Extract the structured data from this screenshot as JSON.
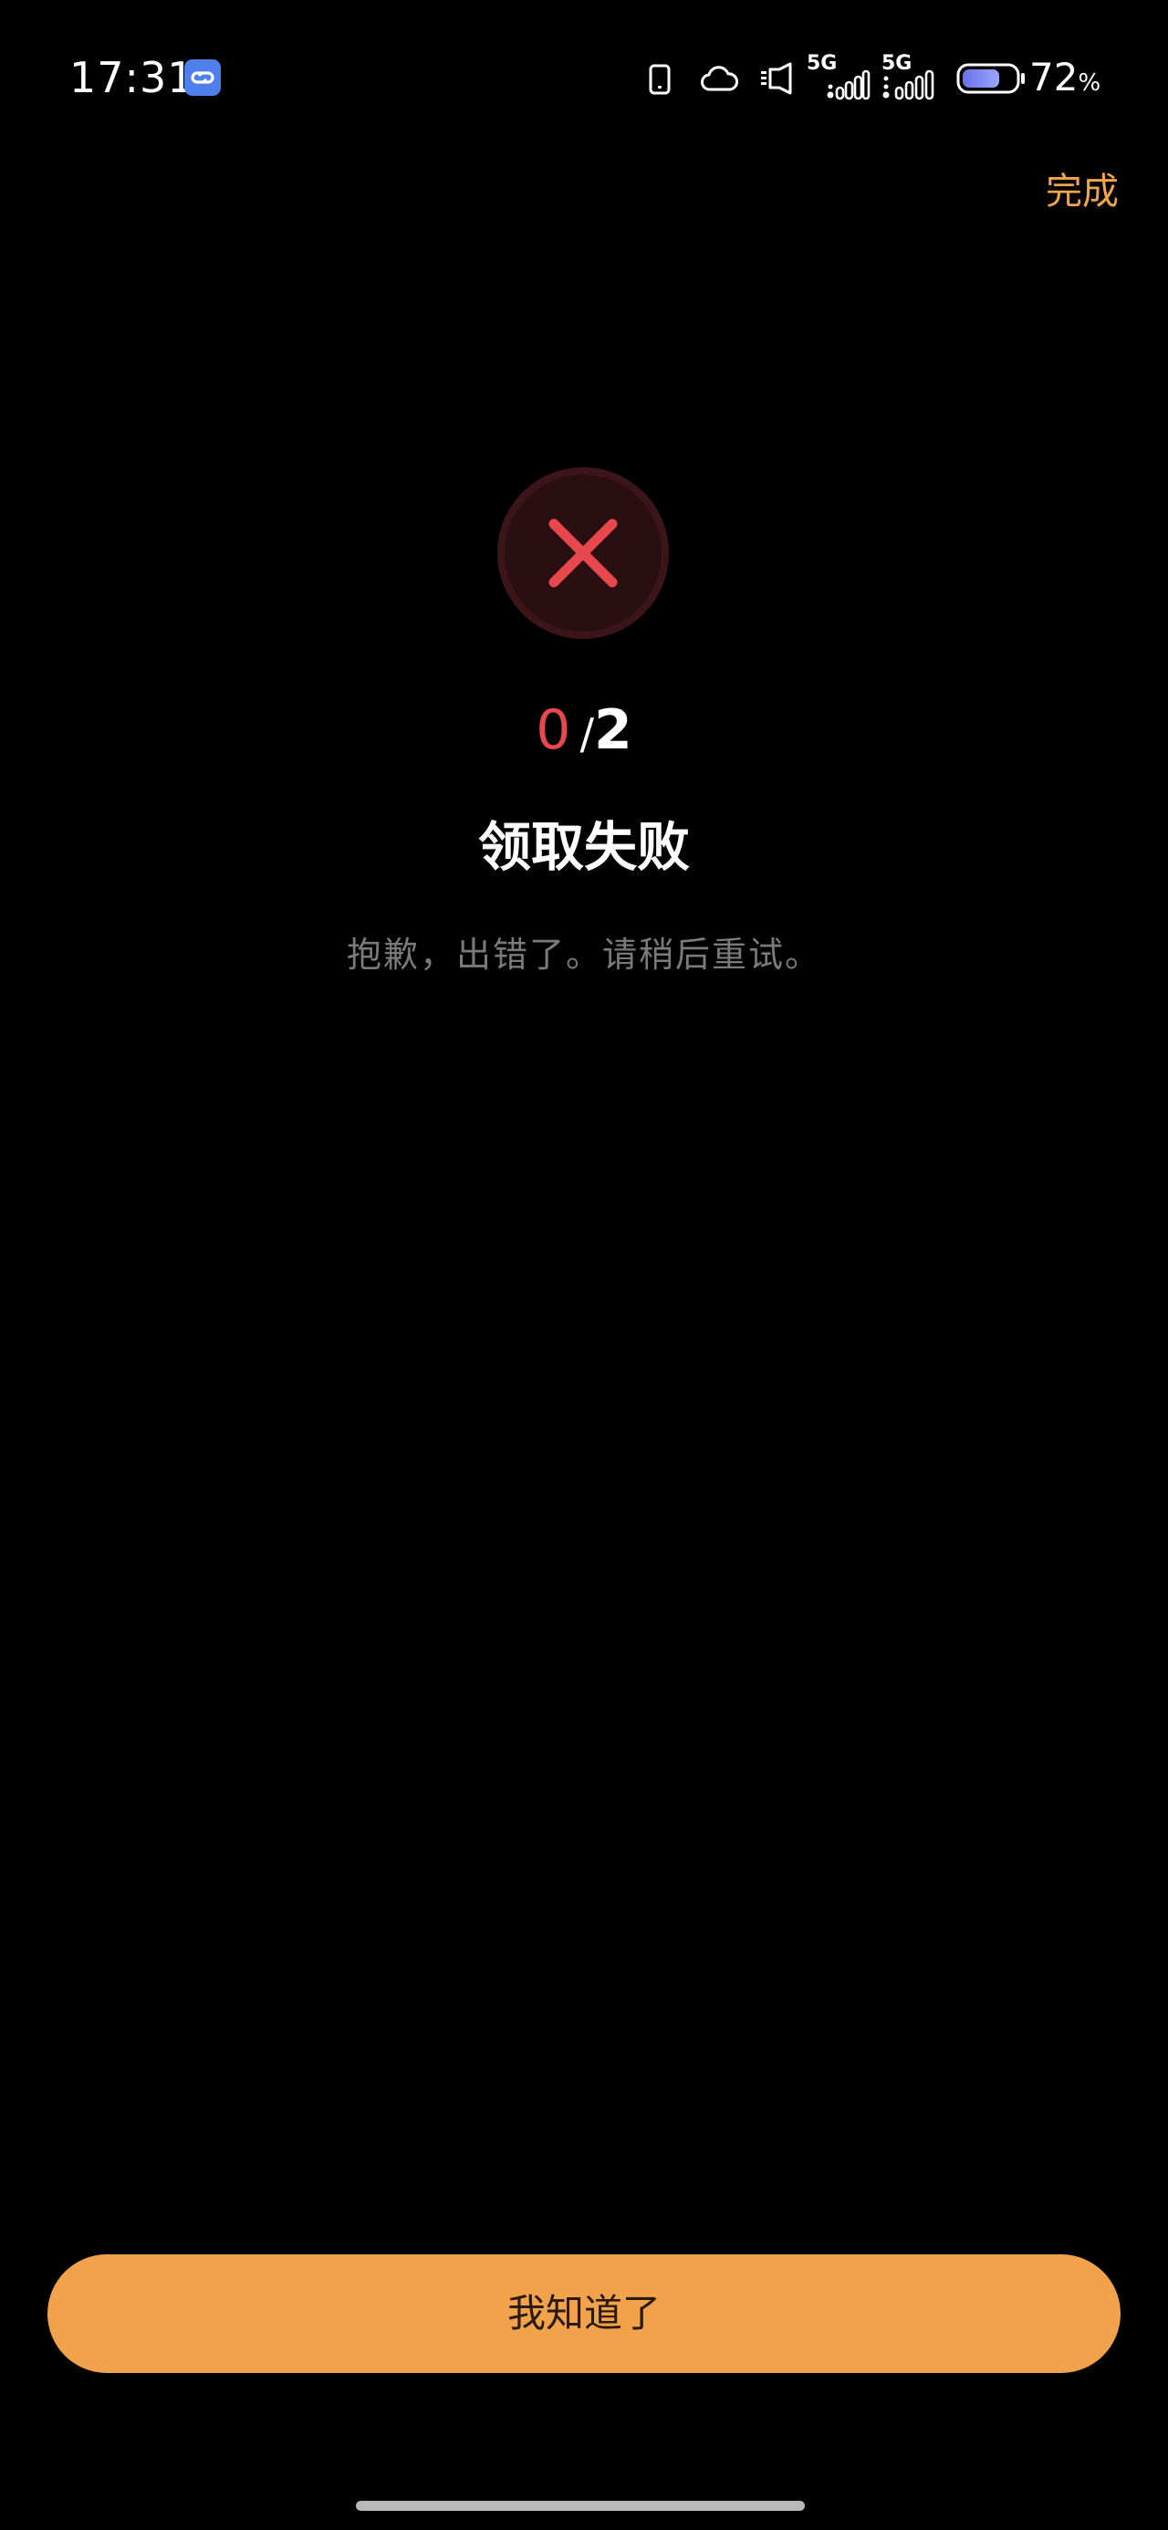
{
  "status_bar": {
    "time": "17:31",
    "app_badge_icon": "link-icon",
    "icons": [
      "phone-icon",
      "cloud-icon",
      "speaker-icon",
      "signal-5g-icon",
      "signal-5g-icon",
      "battery-icon"
    ],
    "network_labels": [
      "5G",
      "5G"
    ],
    "battery_percent": "72",
    "battery_percent_sign": "%",
    "battery_level": 0.72
  },
  "header": {
    "done_label": "完成"
  },
  "result": {
    "status_icon": "close-icon",
    "count_current": "0",
    "count_separator": "/",
    "count_total": "2",
    "title": "领取失败",
    "message": "抱歉，出错了。请稍后重试。"
  },
  "footer": {
    "confirm_label": "我知道了"
  },
  "colors": {
    "background": "#000000",
    "accent": "#f3a24c",
    "done_text": "#f2a44b",
    "error": "#e7474d",
    "error_circle": "#2a0f12",
    "muted_text": "#7a7a7a"
  }
}
